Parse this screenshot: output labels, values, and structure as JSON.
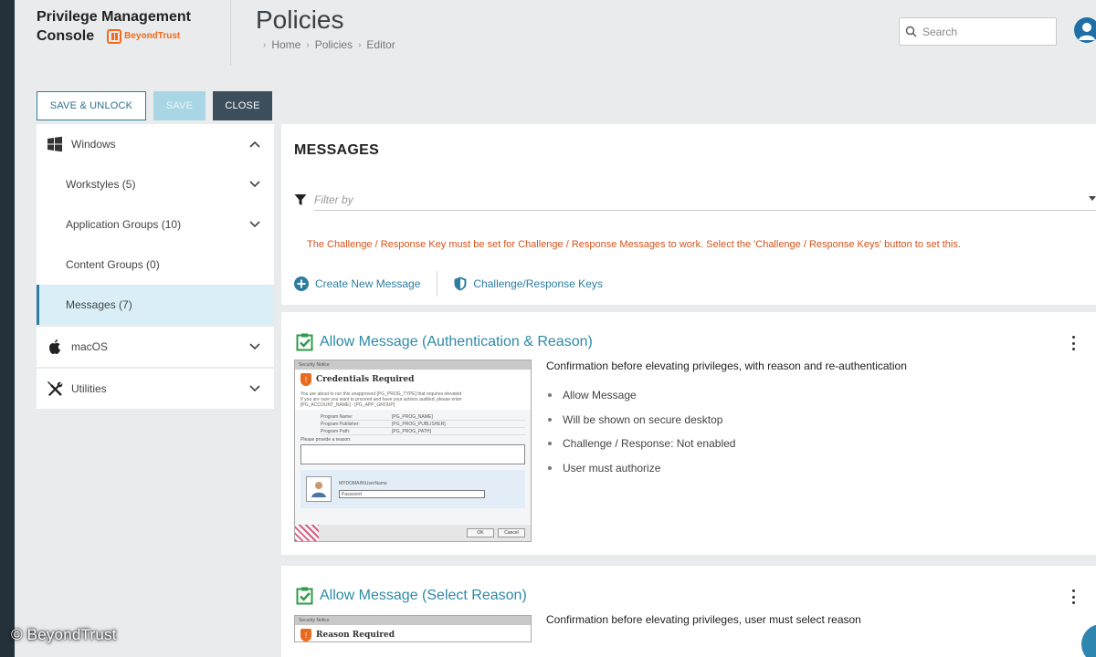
{
  "header": {
    "brand_line1": "Privilege Management",
    "brand_line2": "Console",
    "brand_logo_text": "BeyondTrust",
    "page_title": "Policies",
    "breadcrumb": [
      "Home",
      "Policies",
      "Editor"
    ],
    "search_placeholder": "Search"
  },
  "toolbar": {
    "save_unlock_label": "SAVE & UNLOCK",
    "save_label": "SAVE",
    "close_label": "CLOSE"
  },
  "sidebar": {
    "groups": [
      {
        "label": "Windows",
        "icon": "windows-icon",
        "expanded": true,
        "children": [
          {
            "label": "Workstyles (5)"
          },
          {
            "label": "Application Groups (10)"
          },
          {
            "label": "Content Groups (0)"
          },
          {
            "label": "Messages (7)",
            "active": true
          }
        ]
      },
      {
        "label": "macOS",
        "icon": "apple-icon",
        "expanded": false
      },
      {
        "label": "Utilities",
        "icon": "tools-icon",
        "expanded": false
      }
    ]
  },
  "messages": {
    "title": "MESSAGES",
    "filter_placeholder": "Filter by",
    "warning": "The Challenge / Response Key must be set for Challenge / Response Messages to work. Select the 'Challenge / Response Keys' button to set this.",
    "create_label": "Create New Message",
    "keys_label": "Challenge/Response Keys"
  },
  "cards": [
    {
      "title": "Allow Message (Authentication & Reason)",
      "description": "Confirmation before elevating privileges, with reason and re-authentication",
      "details": [
        "Allow Message",
        "Will be shown on secure desktop",
        "Challenge / Response: Not enabled",
        "User must authorize"
      ],
      "preview": {
        "bar": "Security Notice",
        "title": "Credentials Required",
        "body1": "You are about to run this unapproved [PG_PROG_TYPE] that requires elevated",
        "body2": "If you are sure you want to proceed and have your actions audited, please enter",
        "body3": "[PG_ACCOUNT_NAME] - [PG_APP_GROUP]",
        "rows": [
          {
            "k": "Program Name:",
            "v": "[PG_PROG_NAME]"
          },
          {
            "k": "Program Publisher:",
            "v": "[PG_PROG_PUBLISHER]"
          },
          {
            "k": "Program Path:",
            "v": "[PG_PROG_PATH]"
          }
        ],
        "reason_label": "Please provide a reason:",
        "user_field": "MYDOMAIN\\UserName",
        "password_placeholder": "Password",
        "ok": "OK",
        "cancel": "Cancel"
      }
    },
    {
      "title": "Allow Message (Select Reason)",
      "description": "Confirmation before elevating privileges, user must select reason",
      "preview": {
        "bar": "Security Notice",
        "title": "Reason Required"
      }
    }
  ],
  "watermark": "© BeyondTrust",
  "colors": {
    "accent": "#2c7da0",
    "warning": "#d2541b",
    "brand_orange": "#f26b1d",
    "success_green": "#2e9b48",
    "close_button": "#3d4f5c"
  }
}
